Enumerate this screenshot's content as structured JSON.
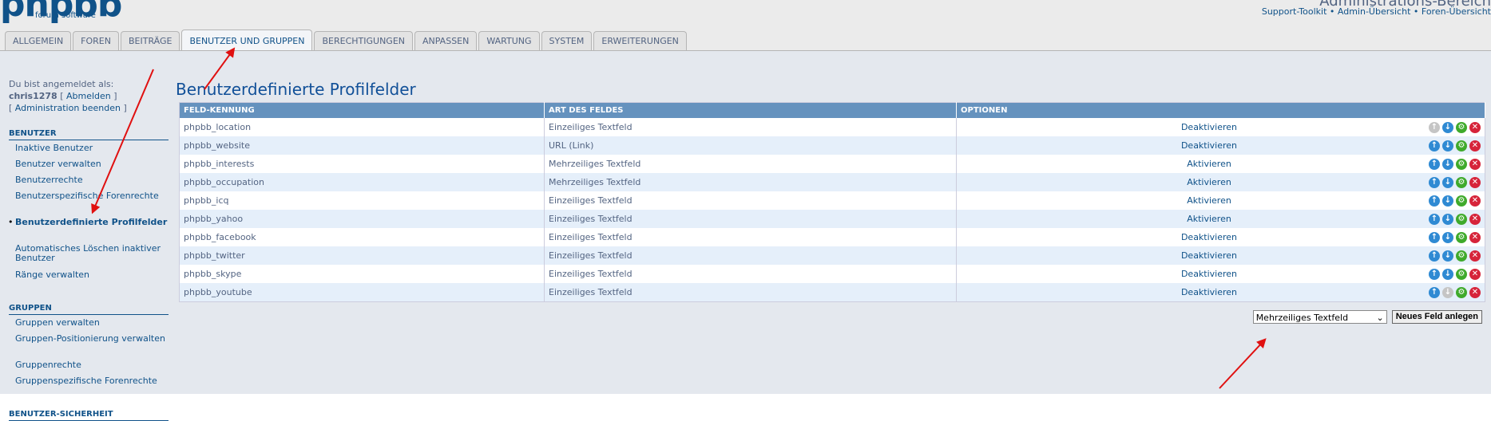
{
  "header": {
    "logo_text": "phpbb",
    "logo_sub": "forum software",
    "admin_title": "Administrations-Bereich",
    "links": [
      "Support-Toolkit",
      "Admin-Übersicht",
      "Foren-Übersicht"
    ],
    "link_separator": "•"
  },
  "tabs": [
    {
      "label": "ALLGEMEIN",
      "active": false
    },
    {
      "label": "FOREN",
      "active": false
    },
    {
      "label": "BEITRÄGE",
      "active": false
    },
    {
      "label": "BENUTZER UND GRUPPEN",
      "active": true
    },
    {
      "label": "BERECHTIGUNGEN",
      "active": false
    },
    {
      "label": "ANPASSEN",
      "active": false
    },
    {
      "label": "WARTUNG",
      "active": false
    },
    {
      "label": "SYSTEM",
      "active": false
    },
    {
      "label": "ERWEITERUNGEN",
      "active": false
    }
  ],
  "sidebar": {
    "login_label": "Du bist angemeldet als:",
    "username": "chris1278",
    "logout": "Abmelden",
    "end_admin": "Administration beenden",
    "sections": [
      {
        "title": "BENUTZER",
        "items": [
          "Inaktive Benutzer",
          "Benutzer verwalten",
          "Benutzerrechte",
          "Benutzerspezifische Forenrechte",
          "Benutzerdefinierte Profilfelder",
          "Automatisches Löschen inaktiver Benutzer",
          "Ränge verwalten"
        ],
        "active_index": 4
      },
      {
        "title": "GRUPPEN",
        "items": [
          "Gruppen verwalten",
          "Gruppen-Positionierung verwalten",
          "Gruppenrechte",
          "Gruppenspezifische Forenrechte"
        ]
      },
      {
        "title": "BENUTZER-SICHERHEIT",
        "items": []
      }
    ]
  },
  "main": {
    "title": "Benutzerdefinierte Profilfelder",
    "columns": [
      "FELD-KENNUNG",
      "ART DES FELDES",
      "OPTIONEN"
    ],
    "rows": [
      {
        "id": "phpbb_location",
        "type": "Einzeiliges Textfeld",
        "option": "Deaktivieren",
        "up_enabled": false,
        "down_enabled": true
      },
      {
        "id": "phpbb_website",
        "type": "URL (Link)",
        "option": "Deaktivieren",
        "up_enabled": true,
        "down_enabled": true
      },
      {
        "id": "phpbb_interests",
        "type": "Mehrzeiliges Textfeld",
        "option": "Aktivieren",
        "up_enabled": true,
        "down_enabled": true
      },
      {
        "id": "phpbb_occupation",
        "type": "Mehrzeiliges Textfeld",
        "option": "Aktivieren",
        "up_enabled": true,
        "down_enabled": true
      },
      {
        "id": "phpbb_icq",
        "type": "Einzeiliges Textfeld",
        "option": "Aktivieren",
        "up_enabled": true,
        "down_enabled": true
      },
      {
        "id": "phpbb_yahoo",
        "type": "Einzeiliges Textfeld",
        "option": "Aktivieren",
        "up_enabled": true,
        "down_enabled": true
      },
      {
        "id": "phpbb_facebook",
        "type": "Einzeiliges Textfeld",
        "option": "Deaktivieren",
        "up_enabled": true,
        "down_enabled": true
      },
      {
        "id": "phpbb_twitter",
        "type": "Einzeiliges Textfeld",
        "option": "Deaktivieren",
        "up_enabled": true,
        "down_enabled": true
      },
      {
        "id": "phpbb_skype",
        "type": "Einzeiliges Textfeld",
        "option": "Deaktivieren",
        "up_enabled": true,
        "down_enabled": true
      },
      {
        "id": "phpbb_youtube",
        "type": "Einzeiliges Textfeld",
        "option": "Deaktivieren",
        "up_enabled": true,
        "down_enabled": false
      }
    ],
    "new_field_select": "Mehrzeiliges Textfeld",
    "new_field_button": "Neues Feld anlegen"
  },
  "icons": {
    "up": "arrow-up-icon",
    "down": "arrow-down-icon",
    "edit": "gear-icon",
    "delete": "delete-icon"
  },
  "colors": {
    "accent": "#105289",
    "header_bg": "#6592be",
    "row_alt": "#e5effa",
    "annotation": "#e01010"
  }
}
